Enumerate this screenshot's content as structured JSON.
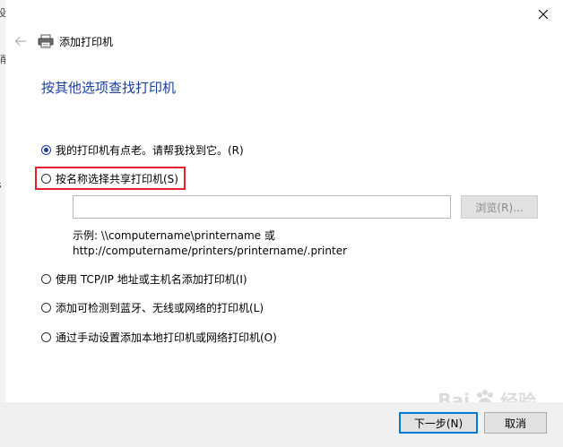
{
  "header": {
    "title": "添加打印机"
  },
  "section_title": "按其他选项查找打印机",
  "options": [
    {
      "label": "我的打印机有点老。请帮我找到它。(R)",
      "checked": true
    },
    {
      "label": "按名称选择共享打印机(S)",
      "checked": false
    },
    {
      "label": "使用 TCP/IP 地址或主机名添加打印机(I)",
      "checked": false
    },
    {
      "label": "添加可检测到蓝牙、无线或网络的打印机(L)",
      "checked": false
    },
    {
      "label": "通过手动设置添加本地打印机或网络打印机(O)",
      "checked": false
    }
  ],
  "share_input": {
    "value": ""
  },
  "browse_label": "浏览(R)...",
  "example": {
    "line1": "示例: \\\\computername\\printername 或",
    "line2": "http://computername/printers/printername/.printer"
  },
  "footer": {
    "next_label": "下一步(N)",
    "cancel_label": "取消"
  },
  "watermark": {
    "text": "Bai",
    "text2": "经验"
  },
  "bg_peek": {
    "glyph1": "设",
    "glyph2": "硝",
    "glyph3": "s"
  },
  "colors": {
    "accent": "#1a3e9e",
    "highlight": "#e5202e",
    "footer_bg": "#f0f0f0"
  }
}
